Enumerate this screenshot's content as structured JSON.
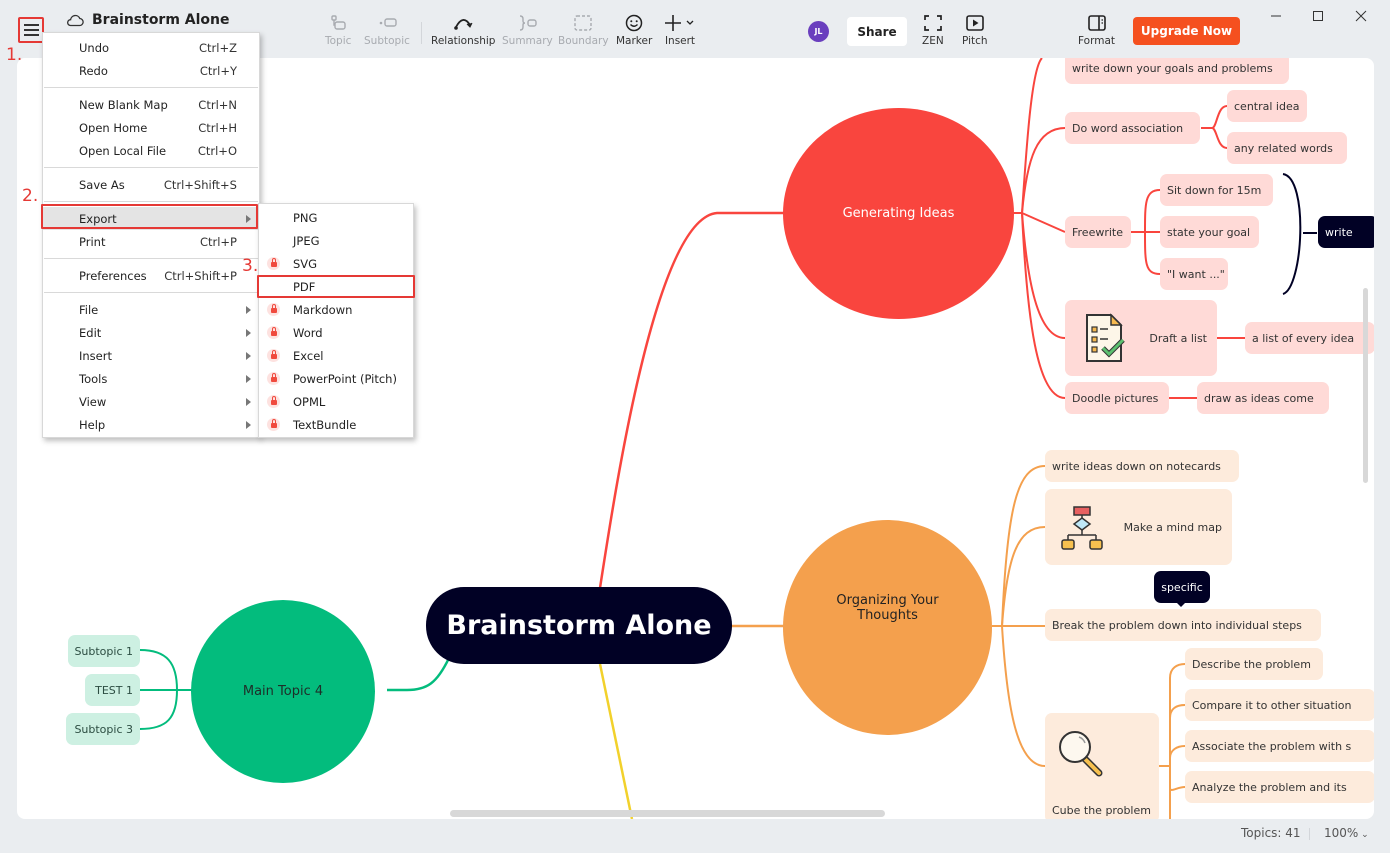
{
  "window": {
    "title": "Brainstorm Alone",
    "controls": [
      "minimize",
      "maximize",
      "close"
    ]
  },
  "toolbar": {
    "items": [
      {
        "label": "Topic",
        "icon": "topic-icon",
        "enabled": false
      },
      {
        "label": "Subtopic",
        "icon": "subtopic-icon",
        "enabled": false
      },
      {
        "label": "Relationship",
        "icon": "relationship-icon",
        "enabled": true
      },
      {
        "label": "Summary",
        "icon": "summary-icon",
        "enabled": false
      },
      {
        "label": "Boundary",
        "icon": "boundary-icon",
        "enabled": false
      },
      {
        "label": "Marker",
        "icon": "smiley-icon",
        "enabled": true
      },
      {
        "label": "Insert",
        "icon": "plus-icon",
        "enabled": true
      }
    ],
    "avatar_initials": "JL",
    "share_label": "Share",
    "zen_label": "ZEN",
    "pitch_label": "Pitch",
    "format_label": "Format",
    "upgrade_label": "Upgrade Now"
  },
  "colors": {
    "accent_upgrade": "#f5501f",
    "annotation_red": "#e53935",
    "avatar": "#6a3fbe",
    "central": "#010125",
    "branch_red": "#f9453e",
    "branch_orange": "#f4a04d",
    "branch_green": "#03bc7d",
    "branch_yellow": "#f2d12b"
  },
  "main_menu": {
    "groups": [
      [
        {
          "label": "Undo",
          "shortcut": "Ctrl+Z"
        },
        {
          "label": "Redo",
          "shortcut": "Ctrl+Y"
        }
      ],
      [
        {
          "label": "New Blank Map",
          "shortcut": "Ctrl+N"
        },
        {
          "label": "Open Home",
          "shortcut": "Ctrl+H"
        },
        {
          "label": "Open Local File",
          "shortcut": "Ctrl+O"
        }
      ],
      [
        {
          "label": "Save As",
          "shortcut": "Ctrl+Shift+S"
        }
      ],
      [
        {
          "label": "Export",
          "shortcut": "",
          "submenu": true,
          "highlighted": true
        },
        {
          "label": "Print",
          "shortcut": "Ctrl+P"
        }
      ],
      [
        {
          "label": "Preferences",
          "shortcut": "Ctrl+Shift+P"
        }
      ],
      [
        {
          "label": "File",
          "submenu": true
        },
        {
          "label": "Edit",
          "submenu": true
        },
        {
          "label": "Insert",
          "submenu": true
        },
        {
          "label": "Tools",
          "submenu": true
        },
        {
          "label": "View",
          "submenu": true
        },
        {
          "label": "Help",
          "submenu": true
        }
      ]
    ]
  },
  "export_menu": {
    "items": [
      {
        "label": "PNG",
        "locked": false
      },
      {
        "label": "JPEG",
        "locked": false
      },
      {
        "label": "SVG",
        "locked": true
      },
      {
        "label": "PDF",
        "locked": false,
        "highlighted": true
      },
      {
        "label": "Markdown",
        "locked": true
      },
      {
        "label": "Word",
        "locked": true
      },
      {
        "label": "Excel",
        "locked": true
      },
      {
        "label": "PowerPoint (Pitch)",
        "locked": true
      },
      {
        "label": "OPML",
        "locked": true
      },
      {
        "label": "TextBundle",
        "locked": true
      }
    ]
  },
  "annotations": {
    "step1": "1.",
    "step2": "2.",
    "step3": "3."
  },
  "mindmap": {
    "central": "Brainstorm Alone",
    "branches": {
      "generating": {
        "label": "Generating Ideas",
        "children": [
          {
            "label": "write down your goals and problems"
          },
          {
            "label": "Do word association",
            "children": [
              "central idea",
              "any related words"
            ]
          },
          {
            "label": "Freewrite",
            "children": [
              "Sit down for 15m",
              "state your goal",
              "\"I want ...\""
            ],
            "summary": "write"
          },
          {
            "label": "Draft a list",
            "icon": "checklist-icon",
            "children": [
              "a list of every idea"
            ]
          },
          {
            "label": "Doodle pictures",
            "children": [
              "draw as ideas come"
            ]
          }
        ]
      },
      "organizing": {
        "label": "Organizing Your Thoughts",
        "children": [
          {
            "label": "write ideas down on notecards"
          },
          {
            "label": "Make a mind map",
            "icon": "flowchart-icon"
          },
          {
            "label": "Break the problem down into individual steps",
            "callout": "specific"
          },
          {
            "label": "Cube the problem",
            "icon": "magnifier-icon",
            "children": [
              "Describe the problem",
              "Compare it to other situation",
              "Associate the problem with s",
              "Analyze the problem and its"
            ]
          }
        ]
      },
      "main4": {
        "label": "Main Topic 4",
        "children": [
          "Subtopic 1",
          "TEST 1",
          "Subtopic 3"
        ]
      }
    }
  },
  "status_bar": {
    "topics": "Topics: 41",
    "zoom": "100%"
  }
}
